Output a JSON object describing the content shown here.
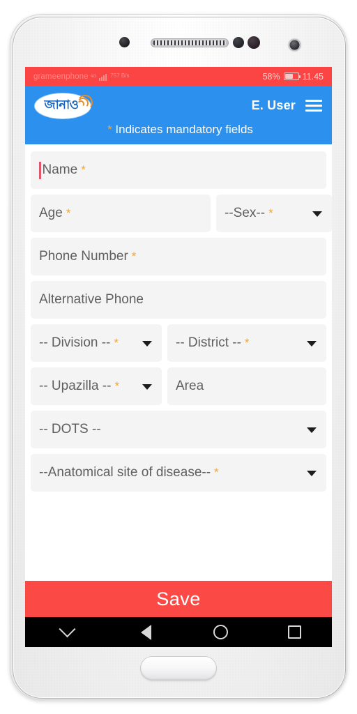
{
  "status_bar": {
    "carrier": "grameenphone",
    "network_type": "4G",
    "data_rate": "757\nB/s",
    "battery_percent": "58%",
    "time": "11.45"
  },
  "app_bar": {
    "logo_text": "জানাও",
    "logo_icon": "signal-waves-icon",
    "user_label": "E. User",
    "menu_icon": "hamburger-menu-icon"
  },
  "notice": {
    "star": "*",
    "text": " Indicates mandatory fields"
  },
  "form": {
    "fields": [
      {
        "name": "name",
        "label": "Name",
        "required": true,
        "type": "text",
        "focused": true
      },
      {
        "name": "age",
        "label": "Age",
        "required": true,
        "type": "text",
        "focused": false
      },
      {
        "name": "sex",
        "label": "--Sex--",
        "required": true,
        "type": "select",
        "focused": false
      },
      {
        "name": "phone-number",
        "label": "Phone Number",
        "required": true,
        "type": "text",
        "focused": false
      },
      {
        "name": "alternative-phone",
        "label": "Alternative Phone",
        "required": false,
        "type": "text",
        "focused": false
      },
      {
        "name": "division",
        "label": "-- Division --",
        "required": true,
        "type": "select",
        "focused": false
      },
      {
        "name": "district",
        "label": "-- District --",
        "required": true,
        "type": "select",
        "focused": false
      },
      {
        "name": "upazilla",
        "label": "-- Upazilla --",
        "required": true,
        "type": "select",
        "focused": false
      },
      {
        "name": "area",
        "label": "Area",
        "required": false,
        "type": "text",
        "focused": false
      },
      {
        "name": "dots",
        "label": "-- DOTS --",
        "required": false,
        "type": "select",
        "focused": false
      },
      {
        "name": "anatomical-site",
        "label": "--Anatomical site of disease--",
        "required": true,
        "type": "select",
        "focused": false
      }
    ],
    "required_marker": "*"
  },
  "save_button": {
    "label": "Save"
  },
  "nav_bar": {
    "hide_keyboard_icon": "chevron-down-icon",
    "back_icon": "back-triangle-icon",
    "home_icon": "home-circle-icon",
    "recents_icon": "recents-square-icon"
  },
  "colors": {
    "status_bar": "#fb4444",
    "app_bar": "#2b90ee",
    "save_button": "#fb4a46",
    "field_background": "#f4f4f4",
    "required_star": "#efa83a",
    "nav_bar": "#000000",
    "caret": "#e3566a"
  }
}
